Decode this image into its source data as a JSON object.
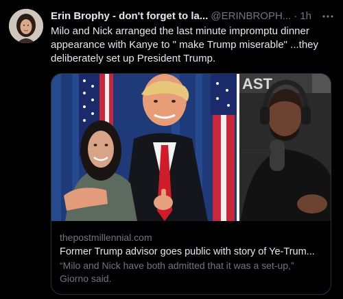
{
  "author": {
    "display_name": "Erin Brophy - don't forget to la...",
    "handle": "@ERINBROPH...",
    "separator": "·",
    "time": "1h",
    "more_icon": "more-dots-icon"
  },
  "tweet": {
    "text": "Milo and Nick arranged the last minute impromptu dinner appearance with Kanye to \" make Trump miserable\" ...they deliberately set up President Trump."
  },
  "card": {
    "domain": "thepostmillennial.com",
    "title": "Former Trump advisor goes public with story of Ye-Trum...",
    "description": "“Milo and Nick have both admitted that it was a set-up,” Giorno said.",
    "image_sign_text": "AST"
  },
  "colors": {
    "background": "#000000",
    "text_primary": "#e7e9ea",
    "text_secondary": "#71767b",
    "border": "#2f3336"
  }
}
